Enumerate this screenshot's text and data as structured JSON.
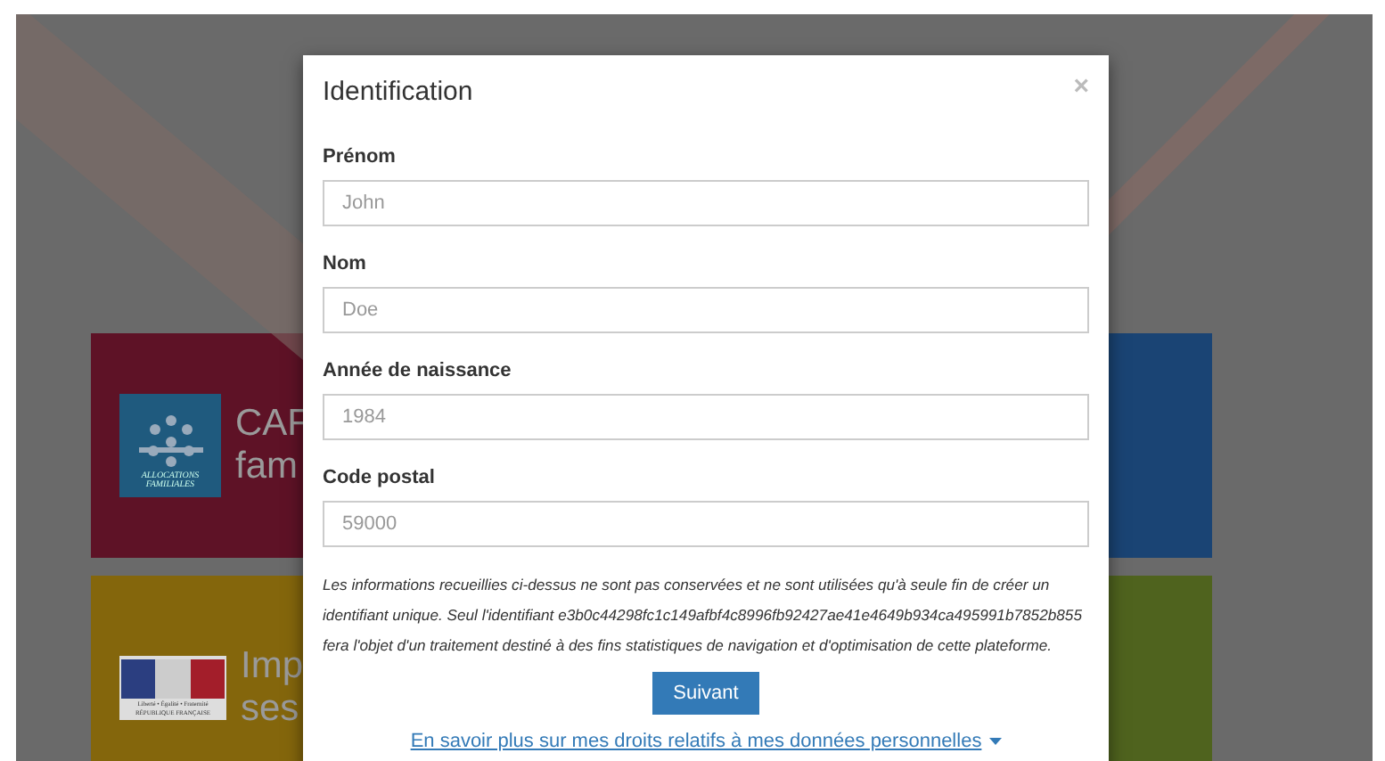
{
  "background": {
    "tiles": [
      {
        "kind": "caf",
        "color": "#5e1226",
        "logo_lines": [
          "ALLOCATIONS",
          "FAMILIALES"
        ],
        "title_lines": [
          "CAF",
          "fam"
        ]
      },
      {
        "kind": "plain",
        "color": "#1a4474"
      },
      {
        "kind": "marianne",
        "color": "#84660c",
        "logo_lines": [
          "Liberté • Égalité • Fraternité",
          "RÉPUBLIQUE FRANÇAISE"
        ],
        "title_lines": [
          "Imp",
          "ses"
        ]
      },
      {
        "kind": "plain",
        "color": "#4f631e"
      }
    ]
  },
  "modal": {
    "title": "Identification",
    "close": "×",
    "fields": [
      {
        "label": "Prénom",
        "placeholder": "John"
      },
      {
        "label": "Nom",
        "placeholder": "Doe"
      },
      {
        "label": "Année de naissance",
        "placeholder": "1984"
      },
      {
        "label": "Code postal",
        "placeholder": "59000"
      }
    ],
    "notice": "Les informations recueillies ci-dessus ne sont pas conservées et ne sont utilisées qu'à seule fin de créer un identifiant unique. Seul l'identifiant e3b0c44298fc1c149afbf4c8996fb92427ae41e4649b934ca495991b7852b855 fera l'objet d'un traitement destiné à des fins statistiques de navigation et d'optimisation de cette plateforme.",
    "button": "Suivant",
    "link": "En savoir plus sur mes droits relatifs à mes données personnelles"
  }
}
